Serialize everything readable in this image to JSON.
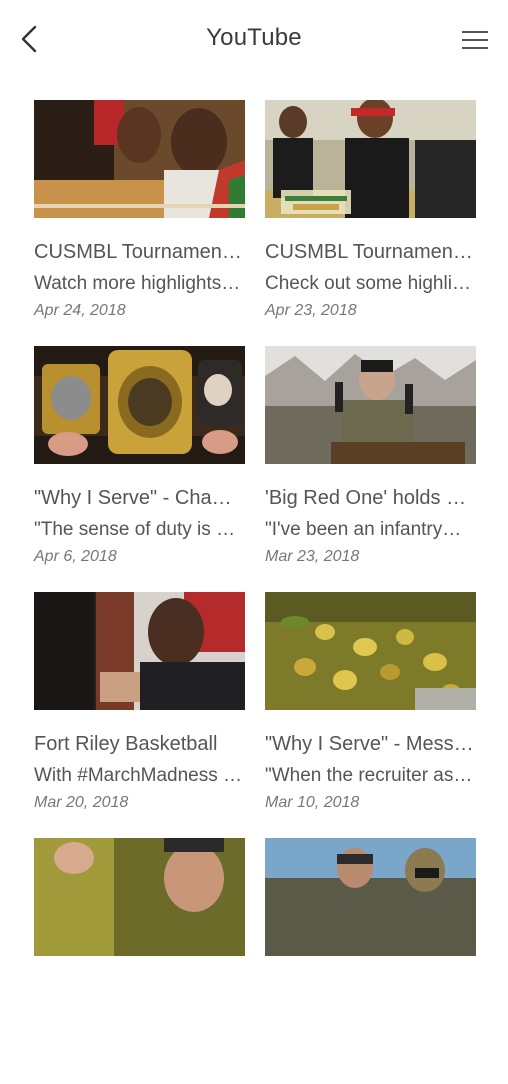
{
  "header": {
    "title": "YouTube",
    "back_icon": "chevron-left-icon",
    "menu_icon": "hamburger-menu-icon"
  },
  "videos": [
    {
      "title": "CUSMBL Tournament Highlights",
      "description": "Watch more highlights from the tournament",
      "date": "Apr 24, 2018",
      "thumb": "basketball-players"
    },
    {
      "title": "CUSMBL Tournament Championship",
      "description": "Check out some highlights",
      "date": "Apr 23, 2018",
      "thumb": "team-lineup"
    },
    {
      "title": "\"Why I Serve\" - Champion",
      "description": "\"The sense of duty is what drives me",
      "date": "Apr 6, 2018",
      "thumb": "championship-belt"
    },
    {
      "title": "'Big Red One' holds ceremony",
      "description": "\"I've been an infantryman",
      "date": "Mar 23, 2018",
      "thumb": "soldier-podium"
    },
    {
      "title": "Fort Riley Basketball",
      "description": "With #MarchMadness underway",
      "date": "Mar 20, 2018",
      "thumb": "coach"
    },
    {
      "title": "\"Why I Serve\" - Mess Sergeant",
      "description": "\"When the recruiter asked me",
      "date": "Mar 10, 2018",
      "thumb": "food-tray"
    },
    {
      "title": "",
      "description": "",
      "date": "",
      "thumb": "referee"
    },
    {
      "title": "",
      "description": "",
      "date": "",
      "thumb": "soldiers-field"
    }
  ]
}
